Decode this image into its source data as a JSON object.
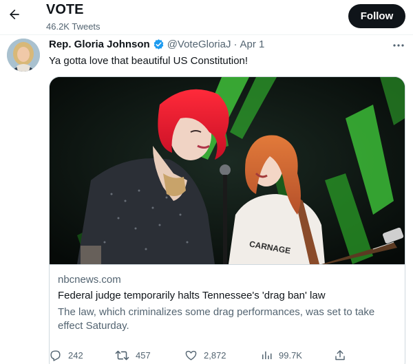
{
  "header": {
    "back_icon": "arrow-left-icon",
    "title": "VOTE",
    "subtitle": "46.2K Tweets",
    "follow_label": "Follow"
  },
  "tweet": {
    "author_name": "Rep. Gloria Johnson",
    "verified_icon": "verified-badge-icon",
    "handle": "@VoteGloriaJ",
    "separator": "·",
    "date": "Apr 1",
    "more_icon": "more-horizontal-icon",
    "text": "Ya gotta love that beautiful US Constitution!",
    "card": {
      "domain": "nbcnews.com",
      "title": "Federal judge temporarily halts Tennessee's 'drag ban' law",
      "description": "The law, which criminalizes some drag performances, was set to take effect Saturday.",
      "image_shirt_text": "CARNAGE"
    },
    "actions": {
      "replies": "242",
      "retweets": "457",
      "likes": "2,872",
      "views": "99.7K"
    }
  },
  "colors": {
    "text_primary": "#0f1419",
    "text_secondary": "#536471",
    "border": "#cfd9de",
    "verified_blue": "#1d9bf0",
    "follow_bg": "#0f1419"
  }
}
